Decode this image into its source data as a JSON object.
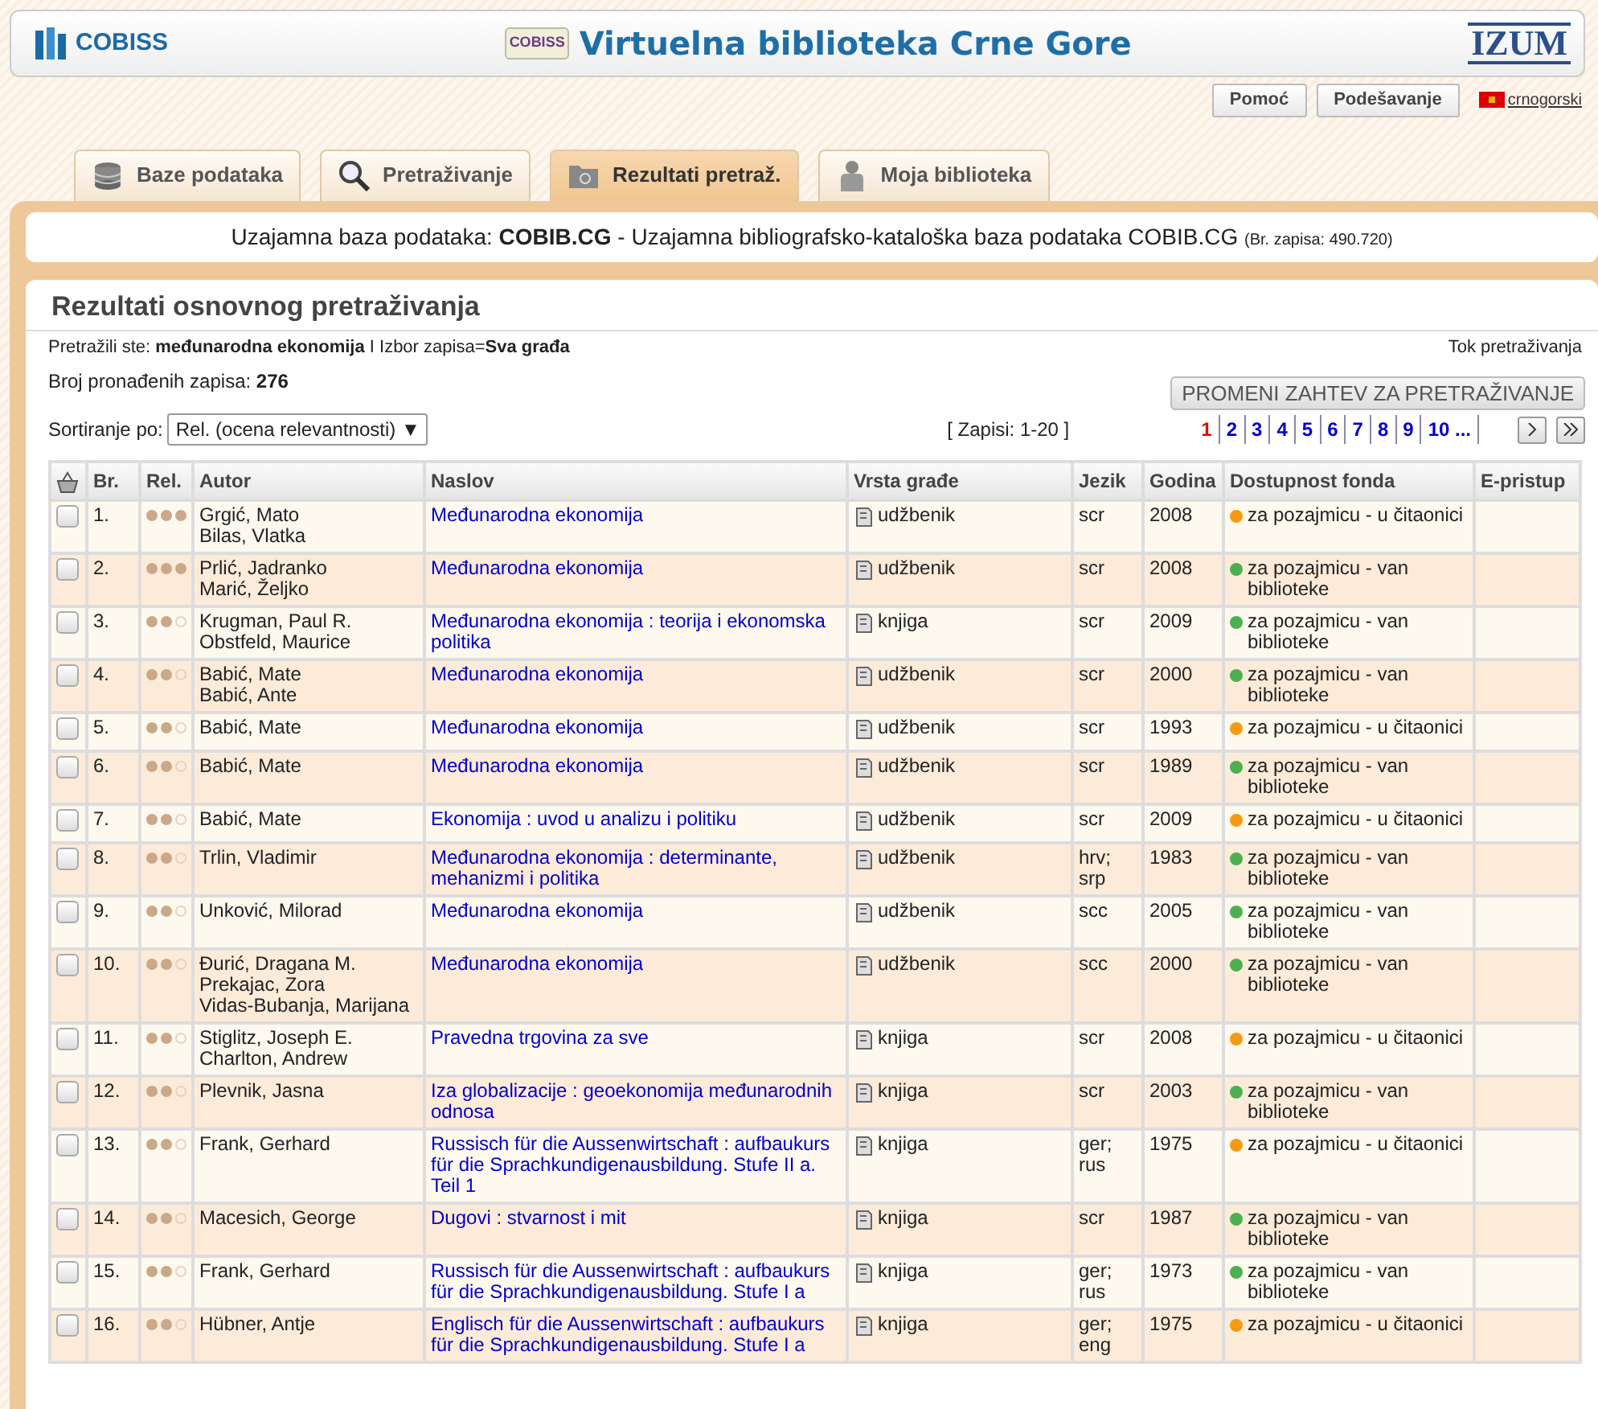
{
  "header": {
    "logo_text": "COBISS",
    "title_logo_text": "COBISS",
    "title": "Virtuelna biblioteka Crne Gore",
    "brand": "IZUM"
  },
  "top_buttons": [
    "Pomoć",
    "Podešavanje"
  ],
  "language": "crnogorski",
  "tabs": [
    {
      "label": "Baze podataka",
      "selected": false
    },
    {
      "label": "Pretraživanje",
      "selected": false
    },
    {
      "label": "Rezultati pretraž.",
      "selected": true
    },
    {
      "label": "Moja biblioteka",
      "selected": false
    }
  ],
  "database_line": "Uzajamna baza podataka: **COBIB.CG** - Uzajamna bibliografsko-kataloška baza podataka COBIB.CG",
  "database_count": "(Br. zapisa: 490.720)",
  "results_title": "Rezultati osnovnog pretraživanja",
  "query_line": "Pretražili ste: **međunarodna ekonomija** I Izbor zapisa=**Sva građa**",
  "history_link": "Tok pretraživanja",
  "count_line": "Broj pronađenih zapisa: **276**",
  "change_button": "PROMENI ZAHTEV ZA PRETRAŽIVANJE",
  "sort_label": "Sortiranje po:",
  "sort_value": "Rel. (ocena relevantnosti) ▼",
  "range": "[ Zapisi: 1-20 ]",
  "pages": [
    {
      "label": "1",
      "selected": true
    },
    {
      "label": "2",
      "selected": false
    },
    {
      "label": "3",
      "selected": false
    },
    {
      "label": "4",
      "selected": false
    },
    {
      "label": "5",
      "selected": false
    },
    {
      "label": "6",
      "selected": false
    },
    {
      "label": "7",
      "selected": false
    },
    {
      "label": "8",
      "selected": false
    },
    {
      "label": "9",
      "selected": false
    },
    {
      "label": "10 ...",
      "selected": false
    }
  ],
  "table": {
    "columns": [
      "Br.",
      "Rel.",
      "Autor",
      "Naslov",
      "Vrsta građe",
      "Jezik",
      "Godina",
      "Dostupnost fonda",
      "E-pristup"
    ],
    "rows": [
      {
        "checked": false,
        "no": "1.",
        "stars": 3,
        "authors": [
          "Grgić, Mato",
          "Bilas, Vlatka"
        ],
        "title": "Međunarodna ekonomija",
        "type": "udžbenik",
        "lang": "scr",
        "year": "2008",
        "availability": "za pozajmicu - u čitaonici",
        "color": "#f39c12"
      },
      {
        "checked": false,
        "no": "2.",
        "stars": 3,
        "authors": [
          "Prlić, Jadranko",
          "Marić, Željko"
        ],
        "title": "Međunarodna ekonomija",
        "type": "udžbenik",
        "lang": "scr",
        "year": "2008",
        "availability": "za pozajmicu - van biblioteke",
        "color": "#4caf50"
      },
      {
        "checked": false,
        "no": "3.",
        "stars": 2,
        "authors": [
          "Krugman, Paul R.",
          "Obstfeld, Maurice"
        ],
        "title": "Međunarodna ekonomija : teorija i ekonomska politika",
        "type": "knjiga",
        "lang": "scr",
        "year": "2009",
        "availability": "za pozajmicu - van biblioteke",
        "color": "#4caf50"
      },
      {
        "checked": false,
        "no": "4.",
        "stars": 2,
        "authors": [
          "Babić, Mate",
          "Babić, Ante"
        ],
        "title": "Međunarodna ekonomija",
        "type": "udžbenik",
        "lang": "scr",
        "year": "2000",
        "availability": "za pozajmicu - van biblioteke",
        "color": "#4caf50"
      },
      {
        "checked": false,
        "no": "5.",
        "stars": 2,
        "authors": [
          "Babić, Mate"
        ],
        "title": "Međunarodna ekonomija",
        "type": "udžbenik",
        "lang": "scr",
        "year": "1993",
        "availability": "za pozajmicu - u čitaonici",
        "color": "#f39c12"
      },
      {
        "checked": false,
        "no": "6.",
        "stars": 2,
        "authors": [
          "Babić, Mate"
        ],
        "title": "Međunarodna ekonomija",
        "type": "udžbenik",
        "lang": "scr",
        "year": "1989",
        "availability": "za pozajmicu - van biblioteke",
        "color": "#4caf50"
      },
      {
        "checked": false,
        "no": "7.",
        "stars": 2,
        "authors": [
          "Babić, Mate"
        ],
        "title": "Ekonomija : uvod u analizu i politiku",
        "type": "udžbenik",
        "lang": "scr",
        "year": "2009",
        "availability": "za pozajmicu - u čitaonici",
        "color": "#f39c12"
      },
      {
        "checked": false,
        "no": "8.",
        "stars": 2,
        "authors": [
          "Trlin, Vladimir"
        ],
        "title": "Međunarodna ekonomija : determinante, mehanizmi i politika",
        "type": "udžbenik",
        "lang": "hrv; srp",
        "year": "1983",
        "availability": "za pozajmicu - van biblioteke",
        "color": "#4caf50"
      },
      {
        "checked": false,
        "no": "9.",
        "stars": 2,
        "authors": [
          "Unković, Milorad"
        ],
        "title": "Međunarodna ekonomija",
        "type": "udžbenik",
        "lang": "scc",
        "year": "2005",
        "availability": "za pozajmicu - van biblioteke",
        "color": "#4caf50"
      },
      {
        "checked": false,
        "no": "10.",
        "stars": 2,
        "authors": [
          "Đurić, Dragana M.",
          "Prekajac, Zora",
          "Vidas-Bubanja, Marijana"
        ],
        "title": "Međunarodna ekonomija",
        "type": "udžbenik",
        "lang": "scc",
        "year": "2000",
        "availability": "za pozajmicu - van biblioteke",
        "color": "#4caf50"
      },
      {
        "checked": false,
        "no": "11.",
        "stars": 2,
        "authors": [
          "Stiglitz, Joseph E.",
          "Charlton, Andrew"
        ],
        "title": "Pravedna trgovina za sve",
        "type": "knjiga",
        "lang": "scr",
        "year": "2008",
        "availability": "za pozajmicu - u čitaonici",
        "color": "#f39c12"
      },
      {
        "checked": false,
        "no": "12.",
        "stars": 2,
        "authors": [
          "Plevnik, Jasna"
        ],
        "title": "Iza globalizacije : geoekonomija međunarodnih odnosa",
        "type": "knjiga",
        "lang": "scr",
        "year": "2003",
        "availability": "za pozajmicu - van biblioteke",
        "color": "#4caf50"
      },
      {
        "checked": false,
        "no": "13.",
        "stars": 2,
        "authors": [
          "Frank, Gerhard"
        ],
        "title": "Russisch für die Aussenwirtschaft : aufbaukurs für die Sprachkundigenausbildung. Stufe II a. Teil 1",
        "type": "knjiga",
        "lang": "ger; rus",
        "year": "1975",
        "availability": "za pozajmicu - u čitaonici",
        "color": "#f39c12"
      },
      {
        "checked": false,
        "no": "14.",
        "stars": 2,
        "authors": [
          "Macesich, George"
        ],
        "title": "Dugovi : stvarnost i mit",
        "type": "knjiga",
        "lang": "scr",
        "year": "1987",
        "availability": "za pozajmicu - van biblioteke",
        "color": "#4caf50"
      },
      {
        "checked": false,
        "no": "15.",
        "stars": 2,
        "authors": [
          "Frank, Gerhard"
        ],
        "title": "Russisch für die Aussenwirtschaft : aufbaukurs für die Sprachkundigenausbildung. Stufe I a",
        "type": "knjiga",
        "lang": "ger; rus",
        "year": "1973",
        "availability": "za pozajmicu - van biblioteke",
        "color": "#4caf50"
      },
      {
        "checked": false,
        "no": "16.",
        "stars": 2,
        "authors": [
          "Hübner, Antje"
        ],
        "title": "Englisch für die Aussenwirtschaft : aufbaukurs für die Sprachkundigenausbildung. Stufe I a",
        "type": "knjiga",
        "lang": "ger; eng",
        "year": "1975",
        "availability": "za pozajmicu - u čitaonici",
        "color": "#f39c12"
      }
    ]
  }
}
